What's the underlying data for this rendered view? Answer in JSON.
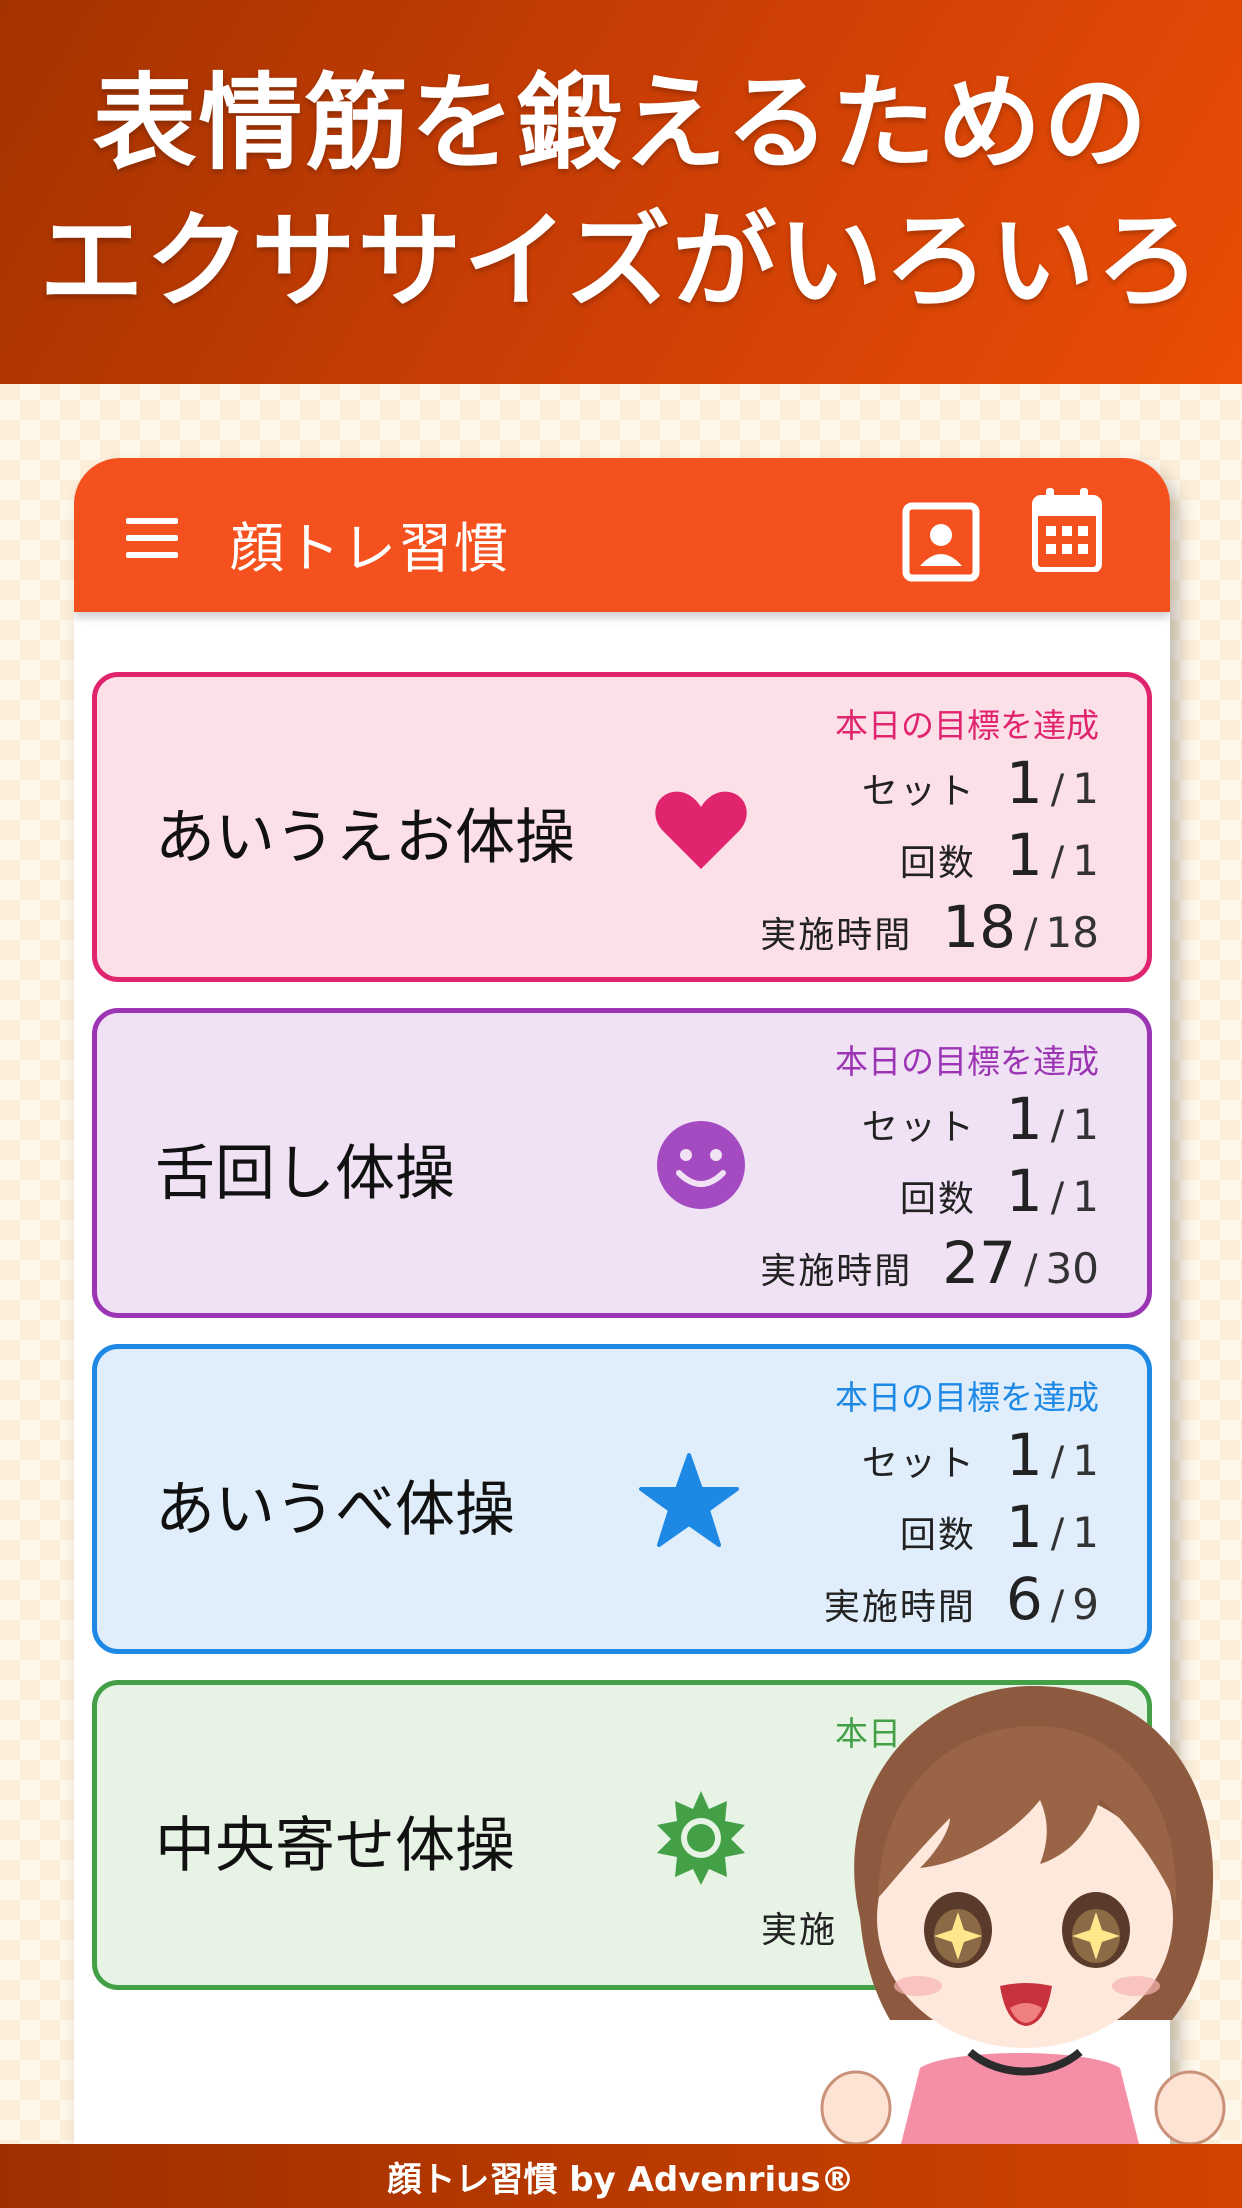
{
  "promo": {
    "line1": "表情筋を鍛えるための",
    "line2": "エクササイズがいろいろ"
  },
  "app_bar": {
    "title": "顔トレ習慣",
    "menu_icon": "hamburger-menu-icon",
    "profile_icon": "profile-portrait-icon",
    "calendar_icon": "calendar-icon",
    "color": "#f4511e"
  },
  "exercises": [
    {
      "name": "あいうえお体操",
      "icon": "heart-icon",
      "accent": "#e0246e",
      "background": "#fce0e8",
      "goal_text": "本日の目標を達成",
      "set_label": "セット",
      "set_value": "1",
      "set_target": "1",
      "count_label": "回数",
      "count_value": "1",
      "count_target": "1",
      "time_label": "実施時間",
      "time_value": "18",
      "time_target": "18"
    },
    {
      "name": "舌回し体操",
      "icon": "smiley-face-icon",
      "accent": "#9c35b4",
      "background": "#f0e2f4",
      "goal_text": "本日の目標を達成",
      "set_label": "セット",
      "set_value": "1",
      "set_target": "1",
      "count_label": "回数",
      "count_value": "1",
      "count_target": "1",
      "time_label": "実施時間",
      "time_value": "27",
      "time_target": "30"
    },
    {
      "name": "あいうべ体操",
      "icon": "star-icon",
      "accent": "#1e88e5",
      "background": "#e0eefb",
      "goal_text": "本日の目標を達成",
      "set_label": "セット",
      "set_value": "1",
      "set_target": "1",
      "count_label": "回数",
      "count_value": "1",
      "count_target": "1",
      "time_label": "実施時間",
      "time_value": "6",
      "time_target": "9"
    },
    {
      "name": "中央寄せ体操",
      "icon": "sun-badge-icon",
      "accent": "#43a047",
      "background": "#e6f3e5",
      "goal_text": "本日",
      "time_label": "実施"
    }
  ],
  "mascot": {
    "icon": "mascot-girl-character"
  },
  "footer": {
    "text": "顔トレ習慣 by Advenrius®"
  }
}
